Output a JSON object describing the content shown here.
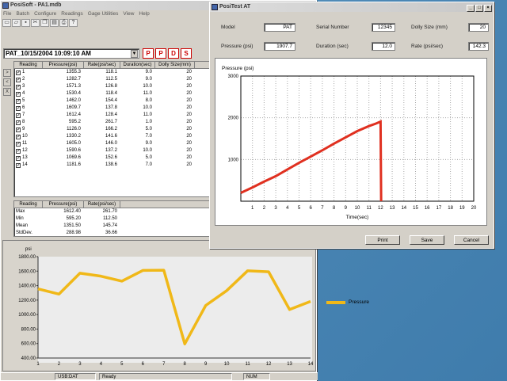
{
  "main_window": {
    "title": "PosiSoft - PA1.mdb",
    "menu": [
      "File",
      "Batch",
      "Configure",
      "Readings",
      "Gage Utilities",
      "View",
      "Help"
    ],
    "toolbar_icons": [
      "new-file-icon",
      "open-folder-icon",
      "save-icon",
      "cut-icon",
      "copy-icon",
      "paste-icon",
      "print-icon",
      "help-icon"
    ],
    "batch_selector": "PAT_10/15/2004 10:09:10 AM",
    "batch_buttons": [
      "P",
      "P",
      "D",
      "S"
    ],
    "side_buttons": [
      ">",
      "<",
      "X"
    ],
    "readings_table": {
      "columns": [
        "Reading",
        "Pressure(psi)",
        "Rate(psi/sec)",
        "Duration(sec)",
        "Dolly Size(mm)"
      ],
      "rows": [
        [
          "1",
          "1355.3",
          "118.1",
          "9.0",
          "20"
        ],
        [
          "2",
          "1282.7",
          "112.5",
          "9.0",
          "20"
        ],
        [
          "3",
          "1571.3",
          "126.8",
          "10.0",
          "20"
        ],
        [
          "4",
          "1530.4",
          "118.4",
          "11.0",
          "20"
        ],
        [
          "5",
          "1462.0",
          "154.4",
          "8.0",
          "20"
        ],
        [
          "6",
          "1609.7",
          "137.8",
          "10.0",
          "20"
        ],
        [
          "7",
          "1612.4",
          "128.4",
          "11.0",
          "20"
        ],
        [
          "8",
          "595.2",
          "261.7",
          "1.0",
          "20"
        ],
        [
          "9",
          "1126.0",
          "166.2",
          "5.0",
          "20"
        ],
        [
          "10",
          "1330.2",
          "141.6",
          "7.0",
          "20"
        ],
        [
          "11",
          "1605.0",
          "146.0",
          "9.0",
          "20"
        ],
        [
          "12",
          "1590.6",
          "137.2",
          "10.0",
          "20"
        ],
        [
          "13",
          "1069.6",
          "152.6",
          "5.0",
          "20"
        ],
        [
          "14",
          "1181.6",
          "138.6",
          "7.0",
          "20"
        ]
      ]
    },
    "stats_table": {
      "columns": [
        "Reading",
        "Pressure(psi)",
        "Rate(psi/sec)"
      ],
      "rows": [
        [
          "Max",
          "1612.40",
          "261.70"
        ],
        [
          "Min",
          "595.20",
          "112.50"
        ],
        [
          "Mean",
          "1351.50",
          "145.74"
        ],
        [
          "StdDev.",
          "288.98",
          "36.66"
        ]
      ]
    },
    "status_bar": [
      "USB:DAT",
      "Ready",
      "NUM"
    ]
  },
  "test_window": {
    "title": "PosiTest AT",
    "fields": {
      "model_label": "Model",
      "model_value": "PAT",
      "serial_label": "Serial Number",
      "serial_value": "12345",
      "dolly_label": "Dolly Size (mm)",
      "dolly_value": "20",
      "pressure_label": "Pressure (psi)",
      "pressure_value": "1907.7",
      "duration_label": "Duration (sec)",
      "duration_value": "12.0",
      "rate_label": "Rate (psi/sec)",
      "rate_value": "142.3"
    },
    "buttons": {
      "print": "Print",
      "save": "Save",
      "cancel": "Cancel"
    }
  },
  "chart_data": [
    {
      "type": "line",
      "ylabel": "Pressure (psi)",
      "xlabel": "Time(sec)",
      "xlim": [
        0,
        20
      ],
      "ylim": [
        0,
        3000
      ],
      "xticks": [
        1,
        2,
        3,
        4,
        5,
        6,
        7,
        8,
        9,
        10,
        11,
        12,
        13,
        14,
        15,
        16,
        17,
        18,
        19,
        20
      ],
      "yticks": [
        1000,
        2000,
        3000
      ],
      "grid": true,
      "color": "#e03020",
      "series": [
        {
          "x": [
            0,
            1,
            2,
            3,
            4,
            5,
            6,
            7,
            8,
            9,
            10,
            11,
            11.6,
            12,
            12.05
          ],
          "y": [
            200,
            330,
            470,
            600,
            760,
            920,
            1070,
            1220,
            1380,
            1530,
            1680,
            1800,
            1860,
            1907.7,
            0
          ]
        }
      ]
    },
    {
      "type": "line",
      "ylabel": "psi",
      "xlim": [
        1,
        14
      ],
      "ylim": [
        400,
        1800
      ],
      "xticks": [
        1,
        2,
        3,
        4,
        5,
        6,
        7,
        8,
        9,
        10,
        11,
        12,
        13,
        14
      ],
      "yticks": [
        "400.00",
        "600.00",
        "800.00",
        "1000.00",
        "1200.00",
        "1400.00",
        "1600.00",
        "1800.00"
      ],
      "grid": false,
      "legend_position": "right",
      "color": "#f0b818",
      "series": [
        {
          "name": "Pressure",
          "x": [
            1,
            2,
            3,
            4,
            5,
            6,
            7,
            8,
            9,
            10,
            11,
            12,
            13,
            14
          ],
          "y": [
            1355.3,
            1282.7,
            1571.3,
            1530.4,
            1462.0,
            1609.7,
            1612.4,
            595.2,
            1126.0,
            1330.2,
            1605.0,
            1590.6,
            1069.6,
            1181.6
          ]
        }
      ]
    }
  ]
}
